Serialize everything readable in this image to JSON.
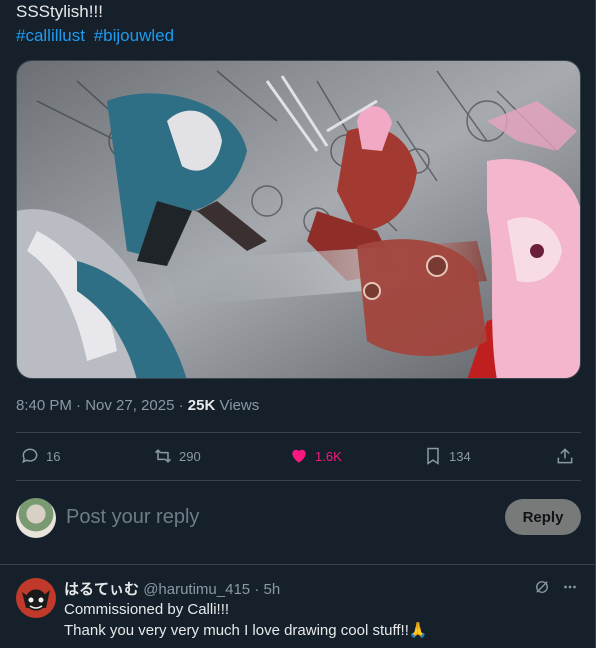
{
  "tweet": {
    "text": "SSStylish!!!",
    "hashtags": [
      "#callillust",
      "#bijouwled"
    ],
    "time": "8:40 PM",
    "date": "Nov 27, 2025",
    "views_count": "25K",
    "views_label": "Views"
  },
  "media": {
    "description": "manga-style illustration with two characters and a crowd of figures",
    "colors": {
      "teal": "#2f6f86",
      "red": "#b02a2a",
      "pink": "#f0a8c8",
      "gray": "#9aa0a6"
    }
  },
  "actions": {
    "replies": "16",
    "reposts": "290",
    "likes": "1.6K",
    "bookmarks": "134"
  },
  "compose": {
    "placeholder": "Post your reply",
    "button": "Reply"
  },
  "reply": {
    "name": "はるてぃむ",
    "handle": "@harutimu_415",
    "time": "5h",
    "lines": [
      "Commissioned by Calli!!!",
      "Thank you very very much I love drawing cool stuff!!🙏"
    ]
  },
  "colors": {
    "background": "#15202b",
    "accent": "#1d9bf0",
    "like": "#f91880",
    "muted": "#8b98a5"
  }
}
